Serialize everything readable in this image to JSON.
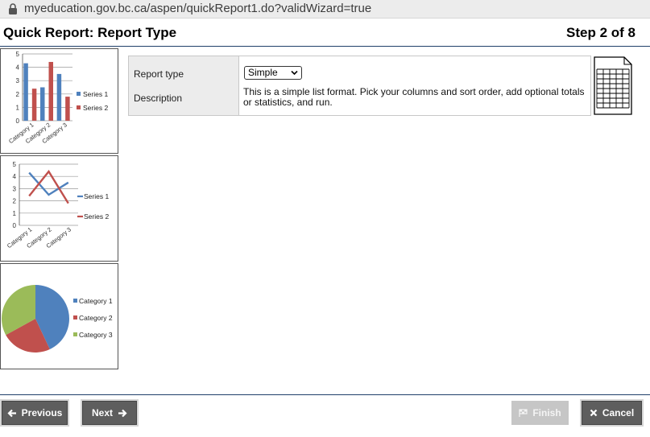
{
  "browser": {
    "url": "myeducation.gov.bc.ca/aspen/quickReport1.do?validWizard=true"
  },
  "header": {
    "title": "Quick Report: Report Type",
    "step": "Step 2 of 8"
  },
  "thumbnails": {
    "bar": {
      "chart_data": {
        "type": "bar",
        "categories": [
          "Category 1",
          "Category 2",
          "Category 3"
        ],
        "series": [
          {
            "name": "Series 1",
            "values": [
              4.3,
              2.5,
              3.5
            ]
          },
          {
            "name": "Series 2",
            "values": [
              2.4,
              4.4,
              1.8
            ]
          }
        ],
        "ylim": [
          0,
          5
        ],
        "yticks": [
          "0",
          "1",
          "2",
          "3",
          "4",
          "5"
        ],
        "legend": "right"
      }
    },
    "line": {
      "chart_data": {
        "type": "line",
        "categories": [
          "Category 1",
          "Category 2",
          "Category 3"
        ],
        "series": [
          {
            "name": "Series 1",
            "values": [
              4.3,
              2.5,
              3.5
            ]
          },
          {
            "name": "Series 2",
            "values": [
              2.4,
              4.4,
              1.8
            ]
          }
        ],
        "ylim": [
          0,
          5
        ],
        "yticks": [
          "0",
          "1",
          "2",
          "3",
          "4",
          "5"
        ],
        "legend": "right"
      }
    },
    "pie": {
      "chart_data": {
        "type": "pie",
        "categories": [
          "Category 1",
          "Category 2",
          "Category 3"
        ],
        "values": [
          43,
          24,
          33
        ],
        "legend": "right"
      }
    }
  },
  "colors": {
    "series1": "#4f81bd",
    "series2": "#c0504d",
    "series3": "#9bbb59",
    "button": "#5e5e5e",
    "header_rule": "#1f3f6a"
  },
  "form": {
    "report_type_label": "Report type",
    "description_label": "Description",
    "report_type_value": "Simple",
    "description": "This is a simple list format. Pick your columns and sort order, add optional totals or statistics, and run."
  },
  "buttons": {
    "previous": "Previous",
    "next": "Next",
    "finish": "Finish",
    "cancel": "Cancel"
  },
  "icons": {
    "lock": "lock-icon",
    "previous": "arrow-left-icon",
    "next": "arrow-right-icon",
    "finish": "flag-icon",
    "cancel": "close-icon",
    "report": "spreadsheet-document-icon"
  }
}
